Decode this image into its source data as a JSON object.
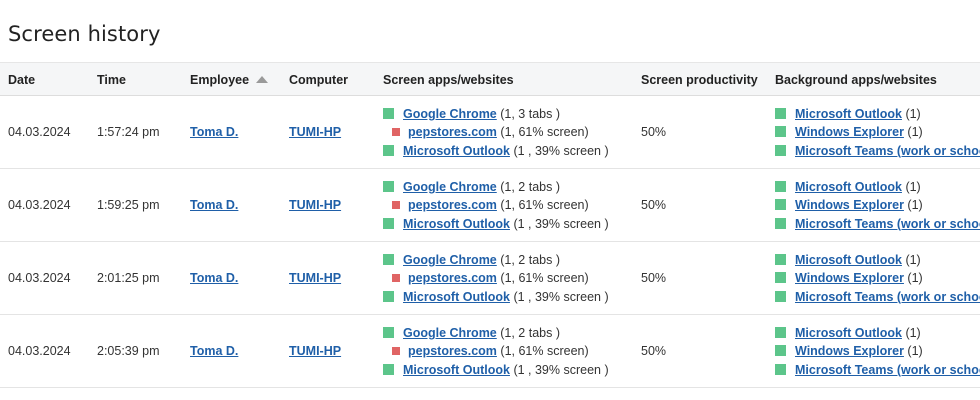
{
  "page": {
    "title": "Screen history"
  },
  "columns": {
    "date": "Date",
    "time": "Time",
    "employee": "Employee",
    "computer": "Computer",
    "screen_apps": "Screen apps/websites",
    "screen_productivity": "Screen productivity",
    "background_apps": "Background apps/websites"
  },
  "rows": [
    {
      "date": "04.03.2024",
      "time": "1:57:24 pm",
      "employee": "Toma D.",
      "computer": "TUMI-HP",
      "screen_apps": [
        {
          "name": "Google Chrome",
          "detail": "(1, 3 tabs )"
        },
        {
          "name": "pepstores.com",
          "detail": "(1, 61% screen)"
        },
        {
          "name": "Microsoft Outlook",
          "detail": "(1 , 39% screen )"
        }
      ],
      "productivity": "50%",
      "background_apps": [
        {
          "name": "Microsoft Outlook",
          "detail": "(1)"
        },
        {
          "name": "Windows Explorer",
          "detail": "(1)"
        },
        {
          "name": "Microsoft Teams (work or school)",
          "detail": ""
        }
      ]
    },
    {
      "date": "04.03.2024",
      "time": "1:59:25 pm",
      "employee": "Toma D.",
      "computer": "TUMI-HP",
      "screen_apps": [
        {
          "name": "Google Chrome",
          "detail": "(1, 2 tabs )"
        },
        {
          "name": "pepstores.com",
          "detail": "(1, 61% screen)"
        },
        {
          "name": "Microsoft Outlook",
          "detail": "(1 , 39% screen )"
        }
      ],
      "productivity": "50%",
      "background_apps": [
        {
          "name": "Microsoft Outlook",
          "detail": "(1)"
        },
        {
          "name": "Windows Explorer",
          "detail": "(1)"
        },
        {
          "name": "Microsoft Teams (work or school)",
          "detail": ""
        }
      ]
    },
    {
      "date": "04.03.2024",
      "time": "2:01:25 pm",
      "employee": "Toma D.",
      "computer": "TUMI-HP",
      "screen_apps": [
        {
          "name": "Google Chrome",
          "detail": "(1, 2 tabs )"
        },
        {
          "name": "pepstores.com",
          "detail": "(1, 61% screen)"
        },
        {
          "name": "Microsoft Outlook",
          "detail": "(1 , 39% screen )"
        }
      ],
      "productivity": "50%",
      "background_apps": [
        {
          "name": "Microsoft Outlook",
          "detail": "(1)"
        },
        {
          "name": "Windows Explorer",
          "detail": "(1)"
        },
        {
          "name": "Microsoft Teams (work or school)",
          "detail": ""
        }
      ]
    },
    {
      "date": "04.03.2024",
      "time": "2:05:39 pm",
      "employee": "Toma D.",
      "computer": "TUMI-HP",
      "screen_apps": [
        {
          "name": "Google Chrome",
          "detail": "(1, 2 tabs )"
        },
        {
          "name": "pepstores.com",
          "detail": "(1, 61% screen)"
        },
        {
          "name": "Microsoft Outlook",
          "detail": "(1 , 39% screen )"
        }
      ],
      "productivity": "50%",
      "background_apps": [
        {
          "name": "Microsoft Outlook",
          "detail": "(1)"
        },
        {
          "name": "Windows Explorer",
          "detail": "(1)"
        },
        {
          "name": "Microsoft Teams (work or school)",
          "detail": ""
        }
      ]
    }
  ],
  "colors": {
    "link": "#1f5fa8",
    "productive_marker": "#5cc58a",
    "unproductive_marker": "#e06464",
    "header_bg": "#f5f6f7"
  },
  "icons": {
    "sort": "sort-ascending-icon",
    "productive": "green-square-icon",
    "unproductive": "red-square-icon"
  }
}
